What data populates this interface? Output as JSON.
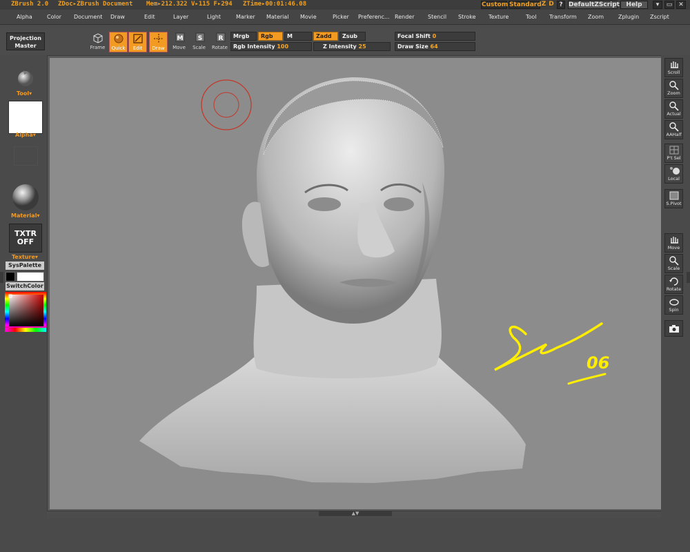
{
  "titlebar": {
    "app": "ZBrush 2.0",
    "doc": "ZDoc▸ZBrush Document",
    "mem": "Mem▸212.322 V▸115 F▸294",
    "ztime": "ZTime▸00:01:46.08",
    "custom": "Custom",
    "standard": "Standard",
    "z": "Z",
    "d": "D",
    "q": "?",
    "default_zscript": "DefaultZScript",
    "help": "Help"
  },
  "menu": [
    "Alpha",
    "Color",
    "Document",
    "Draw",
    "Edit",
    "Layer",
    "Light",
    "Marker",
    "Material",
    "Movie",
    "Picker",
    "Preferenc...",
    "Render",
    "Stencil",
    "Stroke",
    "Texture",
    "Tool",
    "Transform",
    "Zoom",
    "Zplugin",
    "Zscript"
  ],
  "shelf": {
    "projection_master": [
      "Projection",
      "Master"
    ],
    "frame": "Frame",
    "quick": "Quick",
    "edit": "Edit",
    "draw": "Draw",
    "move": "Move",
    "scale": "Scale",
    "rotate": "Rotate",
    "mrgb": "Mrgb",
    "rgb": "Rgb",
    "m": "M",
    "zadd": "Zadd",
    "zsub": "Zsub",
    "rgb_intensity_label": "Rgb Intensity",
    "rgb_intensity_value": "100",
    "z_intensity_label": "Z Intensity",
    "z_intensity_value": "25",
    "focal_shift_label": "Focal Shift",
    "focal_shift_value": "0",
    "draw_size_label": "Draw Size",
    "draw_size_value": "64"
  },
  "left": {
    "tool": "Tool▾",
    "alpha": "Alpha▾",
    "material": "Material▾",
    "txtr_off": [
      "TXTR",
      "OFF"
    ],
    "texture": "Texture▾",
    "syspalette": "SysPalette",
    "switchcolor": "SwitchColor"
  },
  "right": {
    "scroll": "Scroll",
    "zoom": "Zoom",
    "actual": "Actual",
    "aahalf": "AAHalf",
    "ptsel": "P't Sel",
    "local": "Local",
    "spivot": "S.Pivot",
    "move": "Move",
    "scale": "Scale",
    "rotate": "Rotate",
    "spin": "Spin"
  },
  "canvas": {
    "signature_number": "06"
  },
  "colors": {
    "accent": "#f39a22",
    "canvas_bg": "#8c8c8c",
    "signature": "#ffee00",
    "brush_cursor": "#c0392b"
  }
}
